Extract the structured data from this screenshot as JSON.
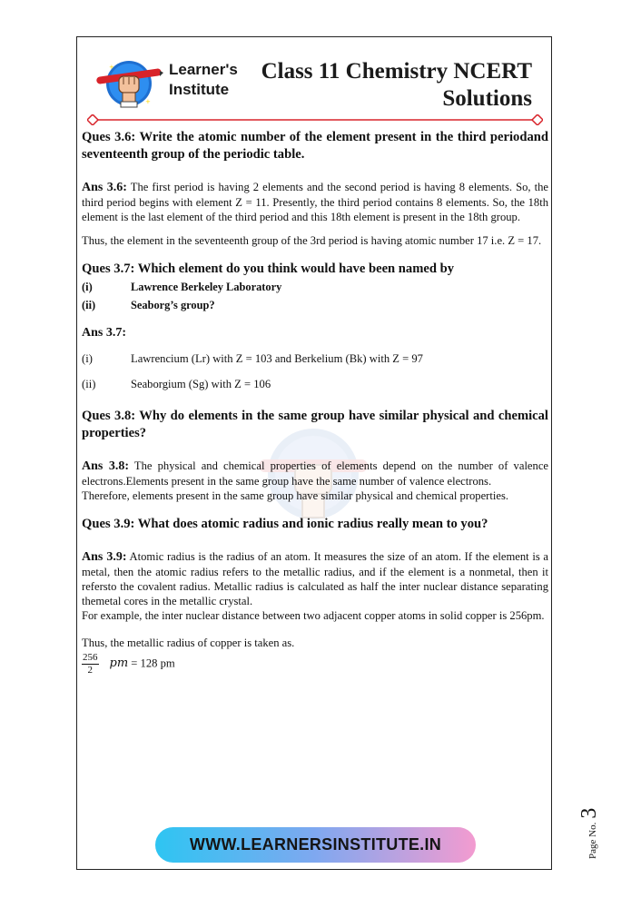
{
  "header": {
    "brand_line1": "Learner's",
    "brand_line2": "Institute",
    "title_line1": "Class 11 Chemistry NCERT",
    "title_line2": "Solutions"
  },
  "q36": {
    "question": "Ques 3.6: Write the atomic number of the element present in the third periodand seventeenth group of the periodic table.",
    "ans_label": "Ans 3.6:",
    "ans_text": " The first period is having 2 elements and the second period is having 8 elements. So, the third period begins with element Z = 11. Presently, the third period contains 8 elements. So, the 18th element is the last element of the third period and this 18th element is present in the 18th group.",
    "ans_text2": "Thus, the element in the seventeenth group of the 3rd period is having atomic number 17 i.e. Z = 17."
  },
  "q37": {
    "question": "Ques 3.7: Which element do you think would have been named by",
    "items": [
      {
        "num": "(i)",
        "text": "Lawrence Berkeley Laboratory"
      },
      {
        "num": "(ii)",
        "text": "Seaborg’s group?"
      }
    ],
    "ans_label": "Ans 3.7:",
    "answers": [
      {
        "num": "(i)",
        "text": "Lawrencium (Lr) with Z = 103 and Berkelium (Bk) with Z = 97"
      },
      {
        "num": "(ii)",
        "text": "Seaborgium (Sg) with Z = 106"
      }
    ]
  },
  "q38": {
    "question": "Ques 3.8: Why do elements in the same group have similar physical and chemical properties?",
    "ans_label": "Ans 3.8:",
    "ans_text": " The physical and chemical properties of elements depend on the number of valence electrons.Elements present in the same group have the same number of valence electrons.",
    "ans_text2": "Therefore, elements present in the same group have similar physical and chemical properties."
  },
  "q39": {
    "question": "Ques 3.9: What does atomic radius and ionic radius really mean to you?",
    "ans_label": "Ans 3.9:",
    "ans_text": " Atomic radius is the radius of an atom. It measures the size of an atom. If the element is a metal, then the atomic radius refers to the metallic radius, and if the element is a nonmetal, then it refersto the covalent radius. Metallic radius is calculated as half the inter nuclear distance separating themetal cores in the metallic crystal.",
    "ans_text2": "For example, the inter nuclear distance between two adjacent copper atoms in solid copper is 256pm.",
    "ans_text3": "Thus, the metallic radius of copper is taken as.",
    "frac_num": "256",
    "frac_den": "2",
    "unit_var": "pm",
    "result": " = 128 pm"
  },
  "footer": {
    "website": "WWW.LEARNERSINSTITUTE.IN",
    "page_label": "Page No.",
    "page_number": "3"
  },
  "colors": {
    "accent_red": "#d8232a",
    "gradient_start": "#2ec5f2",
    "gradient_end": "#f39bd0"
  },
  "icons": {
    "logo": "fist-with-pen-logo",
    "watermark": "fist-with-pen-watermark"
  }
}
